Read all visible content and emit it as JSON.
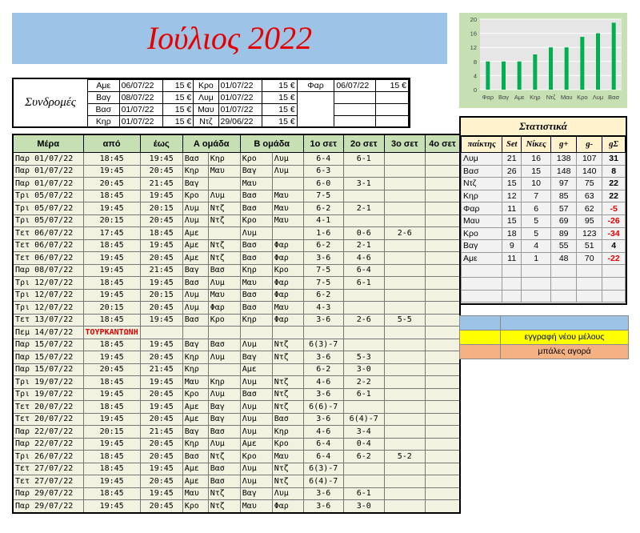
{
  "title": "Ιούλιος 2022",
  "subs": {
    "label": "Συνδρομές",
    "rows": [
      {
        "n1": "Αμε",
        "d1": "06/07/22",
        "p1": "15 €",
        "n2": "Κρο",
        "d2": "01/07/22",
        "p2": "15 €",
        "n3": "Φαρ",
        "d3": "06/07/22",
        "p3": "15 €"
      },
      {
        "n1": "Βαγ",
        "d1": "08/07/22",
        "p1": "15 €",
        "n2": "Λυμ",
        "d2": "01/07/22",
        "p2": "15 €",
        "n3": "",
        "d3": "",
        "p3": ""
      },
      {
        "n1": "Βασ",
        "d1": "01/07/22",
        "p1": "15 €",
        "n2": "Μαυ",
        "d2": "01/07/22",
        "p2": "15 €",
        "n3": "",
        "d3": "",
        "p3": ""
      },
      {
        "n1": "Κηρ",
        "d1": "01/07/22",
        "p1": "15 €",
        "n2": "Ντζ",
        "d2": "29/06/22",
        "p2": "15 €",
        "n3": "",
        "d3": "",
        "p3": ""
      }
    ]
  },
  "schedule": {
    "headers": [
      "Μέρα",
      "από",
      "έως",
      "Α ομάδα",
      "Β ομάδα",
      "1ο σετ",
      "2ο σετ",
      "3ο σετ",
      "4ο σετ"
    ],
    "rows": [
      [
        "Παρ 01/07/22",
        "18:45",
        "19:45",
        "Βασ",
        "Κηρ",
        "Κρο",
        "Λυμ",
        "6-4",
        "6-1",
        "",
        ""
      ],
      [
        "Παρ 01/07/22",
        "19:45",
        "20:45",
        "Κηρ",
        "Μαυ",
        "Βαγ",
        "Λυμ",
        "6-3",
        "",
        "",
        ""
      ],
      [
        "Παρ 01/07/22",
        "20:45",
        "21:45",
        "Βαγ",
        "",
        "Μαυ",
        "",
        "6-0",
        "3-1",
        "",
        ""
      ],
      [
        "Τρι 05/07/22",
        "18:45",
        "19:45",
        "Κρο",
        "Λυμ",
        "Βασ",
        "Μαυ",
        "7-5",
        "",
        "",
        ""
      ],
      [
        "Τρι 05/07/22",
        "19:45",
        "20:15",
        "Λυμ",
        "Ντζ",
        "Βασ",
        "Μαυ",
        "6-2",
        "2-1",
        "",
        ""
      ],
      [
        "Τρι 05/07/22",
        "20:15",
        "20:45",
        "Λυμ",
        "Ντζ",
        "Κρο",
        "Μαυ",
        "4-1",
        "",
        "",
        ""
      ],
      [
        "Τετ 06/07/22",
        "17:45",
        "18:45",
        "Αμε",
        "",
        "Λυμ",
        "",
        "1-6",
        "0-6",
        "2-6",
        ""
      ],
      [
        "Τετ 06/07/22",
        "18:45",
        "19:45",
        "Αμε",
        "Ντζ",
        "Βασ",
        "Φαρ",
        "6-2",
        "2-1",
        "",
        ""
      ],
      [
        "Τετ 06/07/22",
        "19:45",
        "20:45",
        "Αμε",
        "Ντζ",
        "Βασ",
        "Φαρ",
        "3-6",
        "4-6",
        "",
        ""
      ],
      [
        "Παρ 08/07/22",
        "19:45",
        "21:45",
        "Βαγ",
        "Βασ",
        "Κηρ",
        "Κρο",
        "7-5",
        "6-4",
        "",
        ""
      ],
      [
        "Τρι 12/07/22",
        "18:45",
        "19:45",
        "Βασ",
        "Λυμ",
        "Μαυ",
        "Φαρ",
        "7-5",
        "6-1",
        "",
        ""
      ],
      [
        "Τρι 12/07/22",
        "19:45",
        "20:15",
        "Λυμ",
        "Μαυ",
        "Βασ",
        "Φαρ",
        "6-2",
        "",
        "",
        ""
      ],
      [
        "Τρι 12/07/22",
        "20:15",
        "20:45",
        "Λυμ",
        "Φαρ",
        "Βασ",
        "Μαυ",
        "4-3",
        "",
        "",
        ""
      ],
      [
        "Τετ 13/07/22",
        "18:45",
        "19:45",
        "Βασ",
        "Κρο",
        "Κηρ",
        "Φαρ",
        "3-6",
        "2-6",
        "5-5",
        ""
      ],
      [
        "Πεμ 14/07/22",
        "ΤΟΥΡΚΑΝΤΩΝΗ",
        "",
        "",
        "",
        "",
        "",
        "",
        "",
        "",
        ""
      ],
      [
        "Παρ 15/07/22",
        "18:45",
        "19:45",
        "Βαγ",
        "Βασ",
        "Λυμ",
        "Ντζ",
        "6(3)-7",
        "",
        "",
        ""
      ],
      [
        "Παρ 15/07/22",
        "19:45",
        "20:45",
        "Κηρ",
        "Λυμ",
        "Βαγ",
        "Ντζ",
        "3-6",
        "5-3",
        "",
        ""
      ],
      [
        "Παρ 15/07/22",
        "20:45",
        "21:45",
        "Κηρ",
        "",
        "Αμε",
        "",
        "6-2",
        "3-0",
        "",
        ""
      ],
      [
        "Τρι 19/07/22",
        "18:45",
        "19:45",
        "Μαυ",
        "Κηρ",
        "Λυμ",
        "Ντζ",
        "4-6",
        "2-2",
        "",
        ""
      ],
      [
        "Τρι 19/07/22",
        "19:45",
        "20:45",
        "Κρο",
        "Λυμ",
        "Βασ",
        "Ντζ",
        "3-6",
        "6-1",
        "",
        ""
      ],
      [
        "Τετ 20/07/22",
        "18:45",
        "19:45",
        "Αμε",
        "Βαγ",
        "Λυμ",
        "Ντζ",
        "6(6)-7",
        "",
        "",
        ""
      ],
      [
        "Τετ 20/07/22",
        "19:45",
        "20:45",
        "Αμε",
        "Βαγ",
        "Λυμ",
        "Βασ",
        "3-6",
        "6(4)-7",
        "",
        ""
      ],
      [
        "Παρ 22/07/22",
        "20:15",
        "21:45",
        "Βαγ",
        "Βασ",
        "Λυμ",
        "Κηρ",
        "4-6",
        "3-4",
        "",
        ""
      ],
      [
        "Παρ 22/07/22",
        "19:45",
        "20:45",
        "Κηρ",
        "Λυμ",
        "Αμε",
        "Κρο",
        "6-4",
        "0-4",
        "",
        ""
      ],
      [
        "Τρι 26/07/22",
        "18:45",
        "20:45",
        "Βασ",
        "Ντζ",
        "Κρο",
        "Μαυ",
        "6-4",
        "6-2",
        "5-2",
        ""
      ],
      [
        "Τετ 27/07/22",
        "18:45",
        "19:45",
        "Αμε",
        "Βασ",
        "Λυμ",
        "Ντζ",
        "6(3)-7",
        "",
        "",
        ""
      ],
      [
        "Τετ 27/07/22",
        "19:45",
        "20:45",
        "Αμε",
        "Βασ",
        "Λυμ",
        "Ντζ",
        "6(4)-7",
        "",
        "",
        ""
      ],
      [
        "Παρ 29/07/22",
        "18:45",
        "19:45",
        "Μαυ",
        "Ντζ",
        "Βαγ",
        "Λυμ",
        "3-6",
        "6-1",
        "",
        ""
      ],
      [
        "Παρ 29/07/22",
        "19:45",
        "20:45",
        "Κρο",
        "Ντζ",
        "Μαυ",
        "Φαρ",
        "3-6",
        "3-0",
        "",
        ""
      ]
    ]
  },
  "stats": {
    "title": "Στατιστικά",
    "headers": [
      "παίκτης",
      "Set",
      "Νίκες",
      "g+",
      "g-",
      "gΣ"
    ],
    "rows": [
      [
        "Λυμ",
        "21",
        "16",
        "138",
        "107",
        "31"
      ],
      [
        "Βασ",
        "26",
        "15",
        "148",
        "140",
        "8"
      ],
      [
        "Ντζ",
        "15",
        "10",
        "97",
        "75",
        "22"
      ],
      [
        "Κηρ",
        "12",
        "7",
        "85",
        "63",
        "22"
      ],
      [
        "Φαρ",
        "11",
        "6",
        "57",
        "62",
        "-5"
      ],
      [
        "Μαυ",
        "15",
        "5",
        "69",
        "95",
        "-26"
      ],
      [
        "Κρο",
        "18",
        "5",
        "89",
        "123",
        "-34"
      ],
      [
        "Βαγ",
        "9",
        "4",
        "55",
        "51",
        "4"
      ],
      [
        "Αμε",
        "11",
        "1",
        "48",
        "70",
        "-22"
      ]
    ],
    "empty_rows": 3
  },
  "legend": [
    {
      "color": "#9dc3e6",
      "text": ""
    },
    {
      "color": "#ffff00",
      "text": "εγγραφή νέου μέλους"
    },
    {
      "color": "#f4b183",
      "text": "μπάλες αγορά"
    }
  ],
  "chart_data": {
    "type": "bar",
    "categories": [
      "Φαρ",
      "Βαγ",
      "Αμε",
      "Κηρ",
      "Ντζ",
      "Μαυ",
      "Κρο",
      "Λυμ",
      "Βασ"
    ],
    "values": [
      8,
      8,
      8,
      10,
      12,
      12,
      15,
      16,
      19
    ],
    "ylim": [
      0,
      20
    ],
    "yticks": [
      0,
      4,
      8,
      12,
      16,
      20
    ],
    "bar_color": "#00b050",
    "grid": true
  }
}
